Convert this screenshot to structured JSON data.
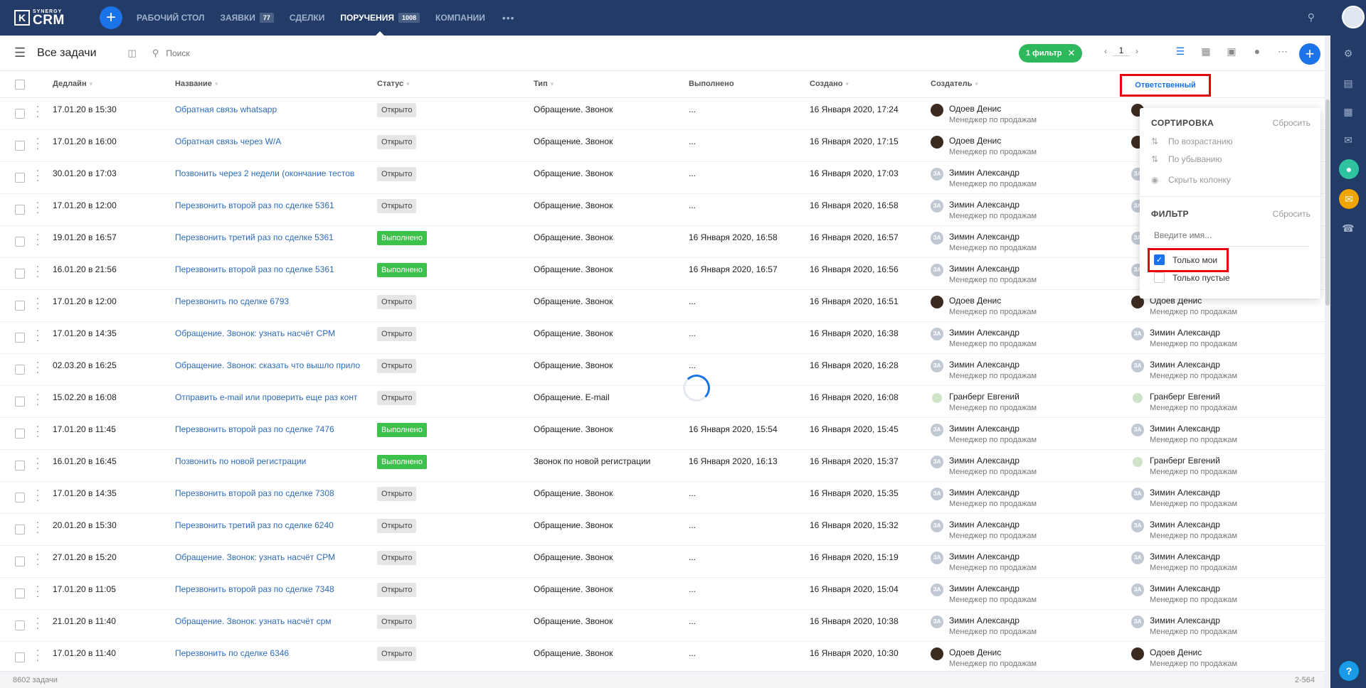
{
  "nav": {
    "logo_top": "SYNERGY",
    "logo_main": "CRM",
    "items": [
      {
        "label": "РАБОЧИЙ СТОЛ",
        "badge": ""
      },
      {
        "label": "ЗАЯВКИ",
        "badge": "77"
      },
      {
        "label": "СДЕЛКИ",
        "badge": ""
      },
      {
        "label": "ПОРУЧЕНИЯ",
        "badge": "1008"
      },
      {
        "label": "КОМПАНИИ",
        "badge": ""
      }
    ],
    "more": "•••"
  },
  "toolbar": {
    "title": "Все задачи",
    "search_placeholder": "Поиск",
    "filter_chip": "1 фильтр",
    "page": "1"
  },
  "columns": {
    "deadline": "Дедлайн",
    "name": "Название",
    "status": "Статус",
    "type": "Тип",
    "done": "Выполнено",
    "created": "Создано",
    "creator": "Создатель",
    "responsible": "Ответственный"
  },
  "dropdown": {
    "sort_title": "СОРТИРОВКА",
    "sort_reset": "Сбросить",
    "asc": "По возрастанию",
    "desc": "По убыванию",
    "hide": "Скрыть колонку",
    "filter_title": "ФИЛЬТР",
    "filter_reset": "Сбросить",
    "name_placeholder": "Введите имя...",
    "only_mine": "Только мои",
    "only_empty": "Только пустые"
  },
  "rows": [
    {
      "deadline": "17.01.20 в 15:30",
      "name": "Обратная связь whatsapp",
      "status": "Открыто",
      "type": "Обращение. Звонок",
      "done": "...",
      "created": "16 Января 2020, 17:24",
      "creator": "Одоев Денис",
      "creator_av": "o",
      "resp": "",
      "resp_av": "o",
      "role": "Менеджер по продажам"
    },
    {
      "deadline": "17.01.20 в 16:00",
      "name": "Обратная связь через W/A",
      "status": "Открыто",
      "type": "Обращение. Звонок",
      "done": "...",
      "created": "16 Января 2020, 17:15",
      "creator": "Одоев Денис",
      "creator_av": "o",
      "resp": "",
      "resp_av": "o",
      "role": "Менеджер по продажам"
    },
    {
      "deadline": "30.01.20 в 17:03",
      "name": "Позвонить через 2 недели (окончание тестов",
      "status": "Открыто",
      "type": "Обращение. Звонок",
      "done": "...",
      "created": "16 Января 2020, 17:03",
      "creator": "Зимин Александр",
      "creator_av": "z",
      "resp": "",
      "resp_av": "z",
      "role": "Менеджер по продажам"
    },
    {
      "deadline": "17.01.20 в 12:00",
      "name": "Перезвонить второй раз по сделке 5361",
      "status": "Открыто",
      "type": "Обращение. Звонок",
      "done": "...",
      "created": "16 Января 2020, 16:58",
      "creator": "Зимин Александр",
      "creator_av": "z",
      "resp": "",
      "resp_av": "z",
      "role": "Менеджер по продажам"
    },
    {
      "deadline": "19.01.20 в 16:57",
      "name": "Перезвонить третий раз по сделке 5361",
      "status": "Выполнено",
      "type": "Обращение. Звонок",
      "done": "16 Января 2020, 16:58",
      "created": "16 Января 2020, 16:57",
      "creator": "Зимин Александр",
      "creator_av": "z",
      "resp": "",
      "resp_av": "z",
      "role": "Менеджер по продажам"
    },
    {
      "deadline": "16.01.20 в 21:56",
      "name": "Перезвонить второй раз по сделке 5361",
      "status": "Выполнено",
      "type": "Обращение. Звонок",
      "done": "16 Января 2020, 16:57",
      "created": "16 Января 2020, 16:56",
      "creator": "Зимин Александр",
      "creator_av": "z",
      "resp": "",
      "resp_av": "z",
      "role": "Менеджер по продажам"
    },
    {
      "deadline": "17.01.20 в 12:00",
      "name": "Перезвонить по сделке 6793",
      "status": "Открыто",
      "type": "Обращение. Звонок",
      "done": "...",
      "created": "16 Января 2020, 16:51",
      "creator": "Одоев Денис",
      "creator_av": "o",
      "resp": "Одоев Денис",
      "resp_av": "o",
      "role": "Менеджер по продажам"
    },
    {
      "deadline": "17.01.20 в 14:35",
      "name": "Обращение. Звонок: узнать насчёт СРМ",
      "status": "Открыто",
      "type": "Обращение. Звонок",
      "done": "...",
      "created": "16 Января 2020, 16:38",
      "creator": "Зимин Александр",
      "creator_av": "z",
      "resp": "Зимин Александр",
      "resp_av": "z",
      "role": "Менеджер по продажам"
    },
    {
      "deadline": "02.03.20 в 16:25",
      "name": "Обращение. Звонок: сказать что вышло прило",
      "status": "Открыто",
      "type": "Обращение. Звонок",
      "done": "...",
      "created": "16 Января 2020, 16:28",
      "creator": "Зимин Александр",
      "creator_av": "z",
      "resp": "Зимин Александр",
      "resp_av": "z",
      "role": "Менеджер по продажам"
    },
    {
      "deadline": "15.02.20 в 16:08",
      "name": "Отправить e-mail или проверить еще раз конт",
      "status": "Открыто",
      "type": "Обращение. E-mail",
      "done": "",
      "created": "16 Января 2020, 16:08",
      "creator": "Гранберг Евгений",
      "creator_av": "g",
      "resp": "Гранберг Евгений",
      "resp_av": "g",
      "role": "Менеджер по продажам"
    },
    {
      "deadline": "17.01.20 в 11:45",
      "name": "Перезвонить второй раз по сделке 7476",
      "status": "Выполнено",
      "type": "Обращение. Звонок",
      "done": "16 Января 2020, 15:54",
      "created": "16 Января 2020, 15:45",
      "creator": "Зимин Александр",
      "creator_av": "z",
      "resp": "Зимин Александр",
      "resp_av": "z",
      "role": "Менеджер по продажам"
    },
    {
      "deadline": "16.01.20 в 16:45",
      "name": "Позвонить по новой регистрации",
      "status": "Выполнено",
      "type": "Звонок по новой регистрации",
      "done": "16 Января 2020, 16:13",
      "created": "16 Января 2020, 15:37",
      "creator": "Зимин Александр",
      "creator_av": "z",
      "resp": "Гранберг Евгений",
      "resp_av": "g",
      "role": "Менеджер по продажам"
    },
    {
      "deadline": "17.01.20 в 14:35",
      "name": "Перезвонить второй раз по сделке 7308",
      "status": "Открыто",
      "type": "Обращение. Звонок",
      "done": "...",
      "created": "16 Января 2020, 15:35",
      "creator": "Зимин Александр",
      "creator_av": "z",
      "resp": "Зимин Александр",
      "resp_av": "z",
      "role": "Менеджер по продажам"
    },
    {
      "deadline": "20.01.20 в 15:30",
      "name": "Перезвонить третий раз по сделке 6240",
      "status": "Открыто",
      "type": "Обращение. Звонок",
      "done": "...",
      "created": "16 Января 2020, 15:32",
      "creator": "Зимин Александр",
      "creator_av": "z",
      "resp": "Зимин Александр",
      "resp_av": "z",
      "role": "Менеджер по продажам"
    },
    {
      "deadline": "27.01.20 в 15:20",
      "name": "Обращение. Звонок: узнать насчёт СРМ",
      "status": "Открыто",
      "type": "Обращение. Звонок",
      "done": "...",
      "created": "16 Января 2020, 15:19",
      "creator": "Зимин Александр",
      "creator_av": "z",
      "resp": "Зимин Александр",
      "resp_av": "z",
      "role": "Менеджер по продажам"
    },
    {
      "deadline": "17.01.20 в 11:05",
      "name": "Перезвонить второй раз по сделке 7348",
      "status": "Открыто",
      "type": "Обращение. Звонок",
      "done": "...",
      "created": "16 Января 2020, 15:04",
      "creator": "Зимин Александр",
      "creator_av": "z",
      "resp": "Зимин Александр",
      "resp_av": "z",
      "role": "Менеджер по продажам"
    },
    {
      "deadline": "21.01.20 в 11:40",
      "name": "Обращение. Звонок: узнать насчёт срм",
      "status": "Открыто",
      "type": "Обращение. Звонок",
      "done": "...",
      "created": "16 Января 2020, 10:38",
      "creator": "Зимин Александр",
      "creator_av": "z",
      "resp": "Зимин Александр",
      "resp_av": "z",
      "role": "Менеджер по продажам"
    },
    {
      "deadline": "17.01.20 в 11:40",
      "name": "Перезвонить по сделке 6346",
      "status": "Открыто",
      "type": "Обращение. Звонок",
      "done": "...",
      "created": "16 Января 2020, 10:30",
      "creator": "Одоев Денис",
      "creator_av": "o",
      "resp": "Одоев Денис",
      "resp_av": "o",
      "role": "Менеджер по продажам"
    }
  ],
  "avatar_initials": "ЗА",
  "footer": {
    "count": "8602 задачи",
    "range": "2-564"
  },
  "colors": {
    "nav_bg": "#233b67",
    "accent": "#1a73e8",
    "done_green": "#3cc14a",
    "highlight_red": "#e8000b"
  }
}
